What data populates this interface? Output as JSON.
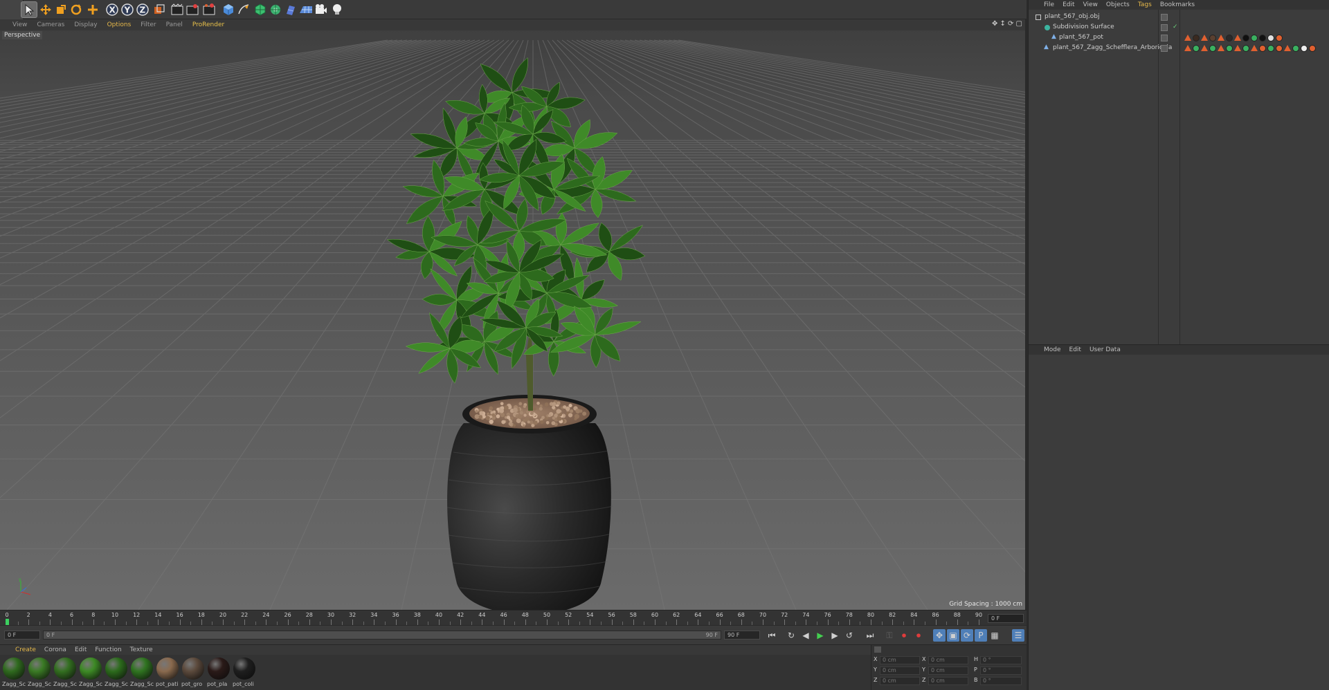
{
  "toolbar": {
    "tools": [
      {
        "icon": "select-arrow-icon",
        "active": true
      },
      {
        "icon": "move-icon"
      },
      {
        "icon": "scale-icon"
      },
      {
        "icon": "rotate-icon"
      },
      {
        "icon": "transform-icon"
      },
      {
        "icon": "x-axis-lock-icon"
      },
      {
        "icon": "y-axis-lock-icon"
      },
      {
        "icon": "z-axis-lock-icon"
      },
      {
        "icon": "coordinate-system-icon"
      },
      {
        "icon": "render-view-icon"
      },
      {
        "icon": "render-picture-viewer-icon"
      },
      {
        "icon": "render-settings-icon"
      },
      {
        "icon": "cube-primitive-icon"
      },
      {
        "icon": "spline-pen-icon"
      },
      {
        "icon": "subdivision-icon"
      },
      {
        "icon": "array-icon"
      },
      {
        "icon": "deformer-icon"
      },
      {
        "icon": "floor-icon"
      },
      {
        "icon": "camera-icon"
      },
      {
        "icon": "light-icon"
      }
    ]
  },
  "viewport": {
    "menu": [
      "View",
      "Cameras",
      "Display",
      "Options",
      "Filter",
      "Panel",
      "ProRender"
    ],
    "camera_label": "Perspective",
    "grid_spacing": "Grid Spacing : 1000 cm"
  },
  "timeline": {
    "ticks": [
      "0",
      "2",
      "4",
      "6",
      "8",
      "10",
      "12",
      "14",
      "16",
      "18",
      "20",
      "22",
      "24",
      "26",
      "28",
      "30",
      "32",
      "34",
      "36",
      "38",
      "40",
      "42",
      "44",
      "46",
      "48",
      "50",
      "52",
      "54",
      "56",
      "58",
      "60",
      "62",
      "64",
      "66",
      "68",
      "70",
      "72",
      "74",
      "76",
      "78",
      "80",
      "82",
      "84",
      "86",
      "88",
      "90"
    ],
    "current_frame": "0 F"
  },
  "transport": {
    "start_field": "0 F",
    "range_start": "0 F",
    "range_end": "90 F",
    "end_field": "90 F"
  },
  "materials": {
    "menu": [
      "Create",
      "Corona",
      "Edit",
      "Function",
      "Texture"
    ],
    "items": [
      {
        "name": "Zagg_Sc",
        "color": "#2f6a1e"
      },
      {
        "name": "Zagg_Sc",
        "color": "#3a7a24"
      },
      {
        "name": "Zagg_Sc",
        "color": "#336f20"
      },
      {
        "name": "Zagg_Sc",
        "color": "#3d8a25"
      },
      {
        "name": "Zagg_Sc",
        "color": "#2c6b1c"
      },
      {
        "name": "Zagg_Sc",
        "color": "#2f7420"
      },
      {
        "name": "pot_pati",
        "color": "#8a6a4e"
      },
      {
        "name": "pot_gro",
        "color": "#5c4a3c"
      },
      {
        "name": "pot_pla",
        "color": "#2a1a18"
      },
      {
        "name": "pot_coli",
        "color": "#1e1e1e"
      }
    ]
  },
  "coords": {
    "rows": [
      {
        "a": "X",
        "av": "0 cm",
        "b": "X",
        "bv": "0 cm",
        "c": "H",
        "cv": "0 °"
      },
      {
        "a": "Y",
        "av": "0 cm",
        "b": "Y",
        "bv": "0 cm",
        "c": "P",
        "cv": "0 °"
      },
      {
        "a": "Z",
        "av": "0 cm",
        "b": "Z",
        "bv": "0 cm",
        "c": "B",
        "cv": "0 °"
      }
    ]
  },
  "objects": {
    "menu": [
      "File",
      "Edit",
      "View",
      "Objects",
      "Tags",
      "Bookmarks"
    ],
    "rows": [
      {
        "name": "plant_567_obj.obj",
        "icon": "null-object-icon"
      },
      {
        "name": "Subdivision Surface",
        "icon": "subdivision-surface-icon"
      },
      {
        "name": "plant_567_pot",
        "icon": "polygon-object-icon"
      },
      {
        "name": "plant_567_Zagg_Schefflera_Arboricola",
        "icon": "polygon-object-icon"
      }
    ]
  },
  "attributes": {
    "menu": [
      "Mode",
      "Edit",
      "User Data"
    ]
  }
}
